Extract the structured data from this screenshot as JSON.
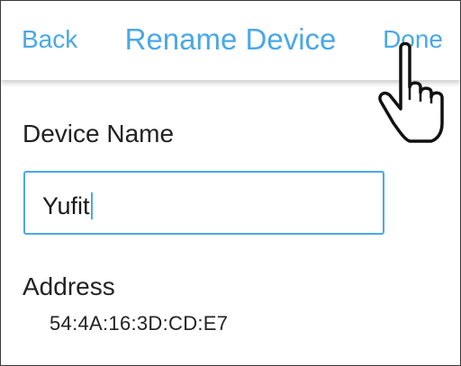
{
  "nav": {
    "back_label": "Back",
    "title": "Rename Device",
    "done_label": "Done"
  },
  "form": {
    "device_name_label": "Device Name",
    "device_name_value": "Yufit",
    "address_label": "Address",
    "address_value": "54:4A:16:3D:CD:E7"
  },
  "colors": {
    "accent": "#4aa8e8",
    "text": "#222222",
    "background": "#ffffff"
  },
  "icons": {
    "pointer": "pointing-hand-cursor-icon"
  }
}
